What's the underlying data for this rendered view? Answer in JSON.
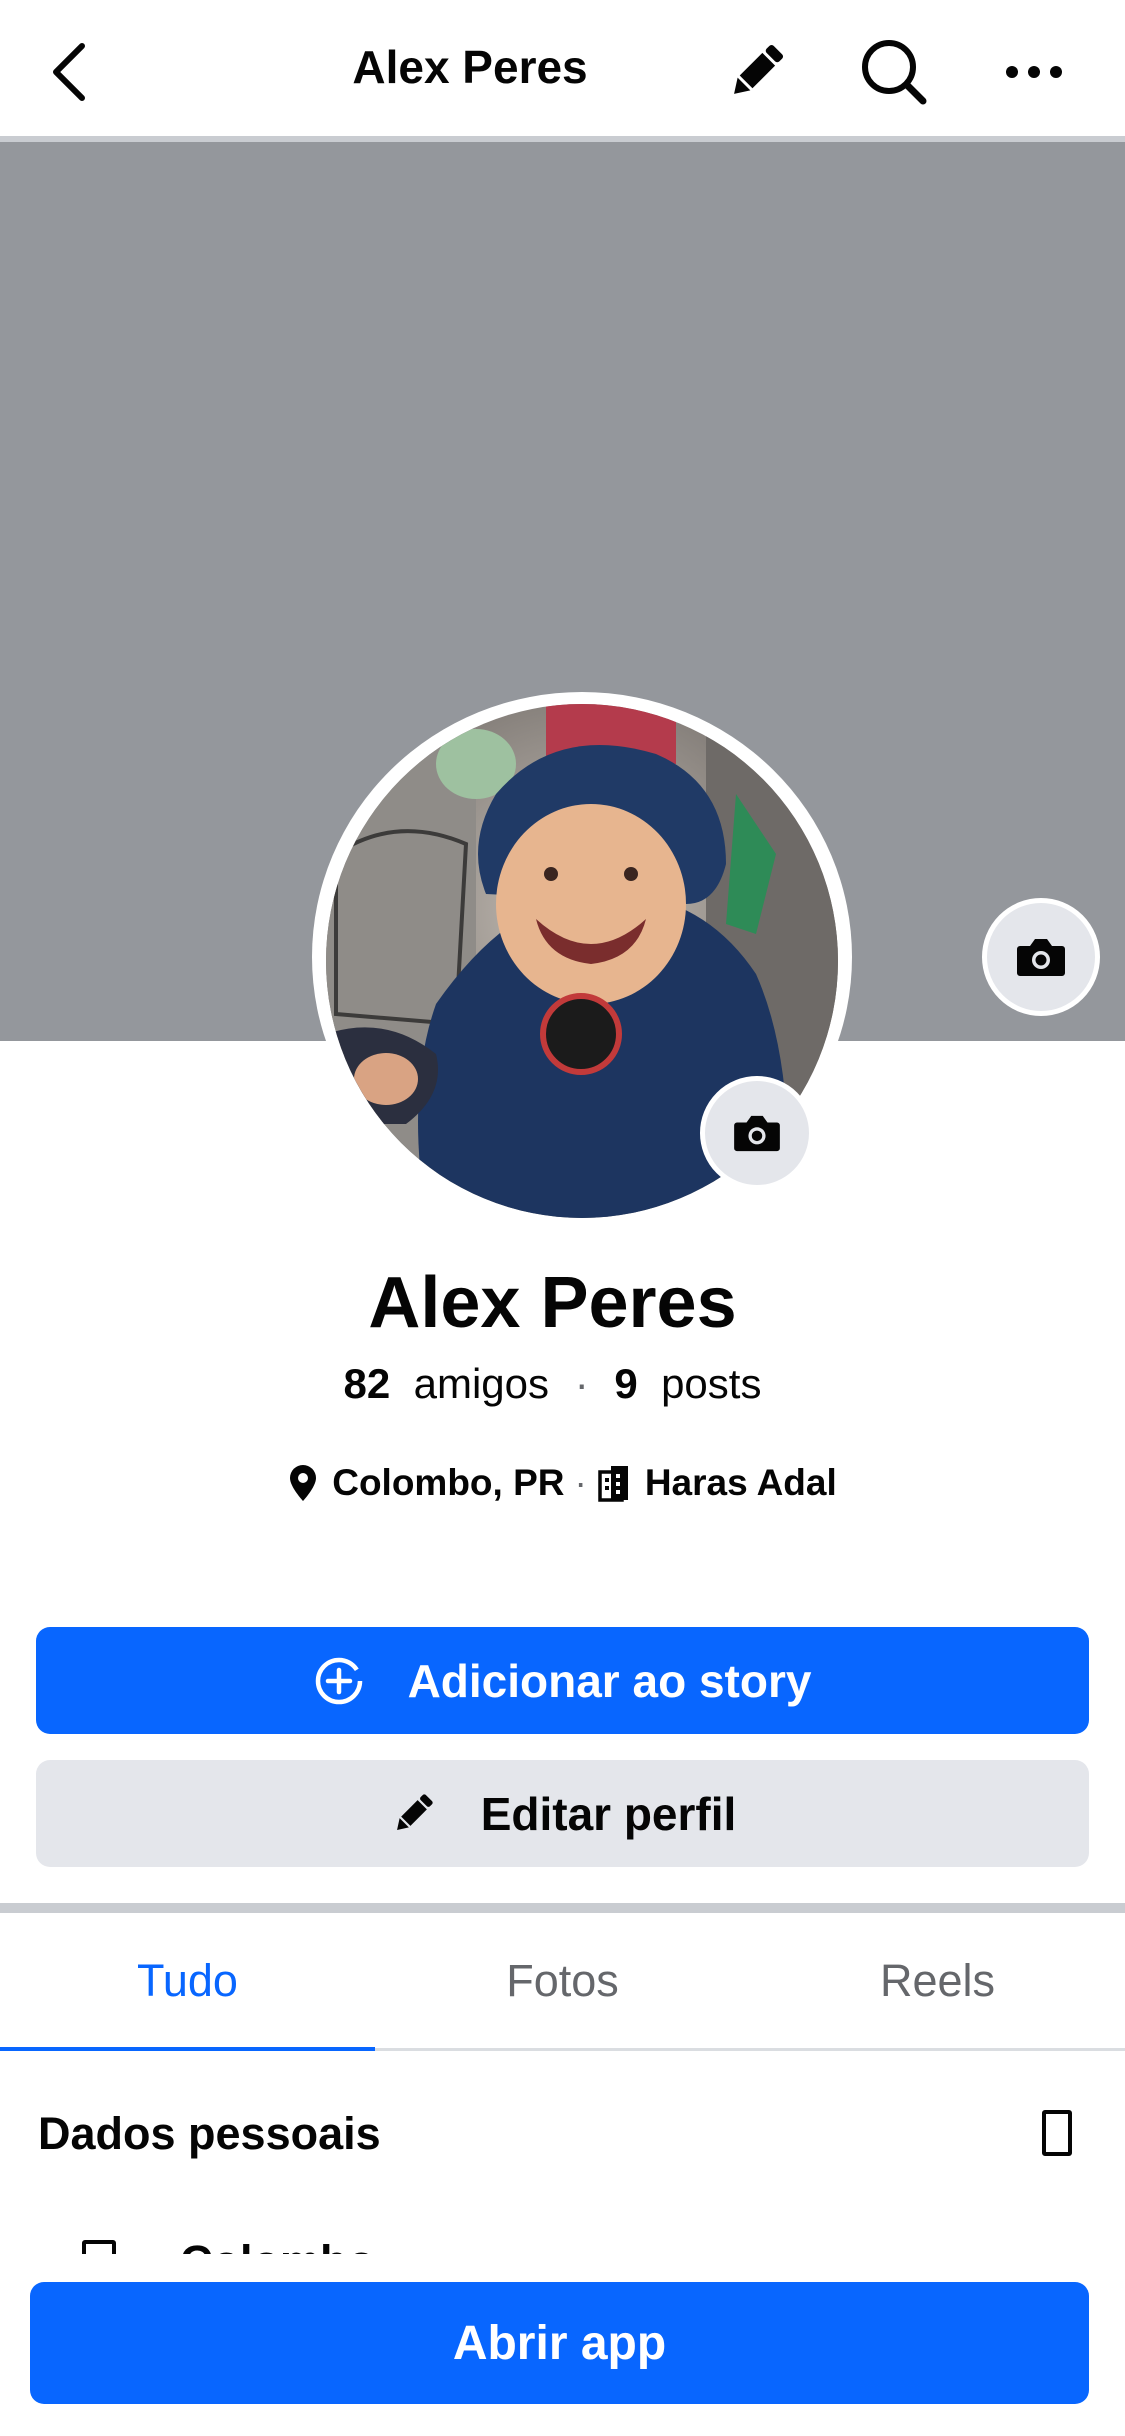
{
  "header": {
    "title": "Alex Peres",
    "back_icon": "chevron-left-icon",
    "edit_icon": "pencil-icon",
    "search_icon": "search-icon",
    "more_icon": "more-horizontal-icon"
  },
  "profile": {
    "name": "Alex Peres",
    "friends_count": "82",
    "friends_label": "amigos",
    "posts_count": "9",
    "posts_label": "posts",
    "location": "Colombo, PR",
    "workplace": "Haras Adal"
  },
  "actions": {
    "add_story": "Adicionar ao story",
    "edit_profile": "Editar perfil"
  },
  "tabs": [
    {
      "label": "Tudo",
      "active": true
    },
    {
      "label": "Fotos",
      "active": false
    },
    {
      "label": "Reels",
      "active": false
    }
  ],
  "about": {
    "title": "Dados pessoais",
    "first_item": "Colombo"
  },
  "footer": {
    "open_app": "Abrir app"
  },
  "colors": {
    "primary": "#0866ff",
    "cover": "#94979c",
    "secondary_button": "#e4e6eb"
  }
}
